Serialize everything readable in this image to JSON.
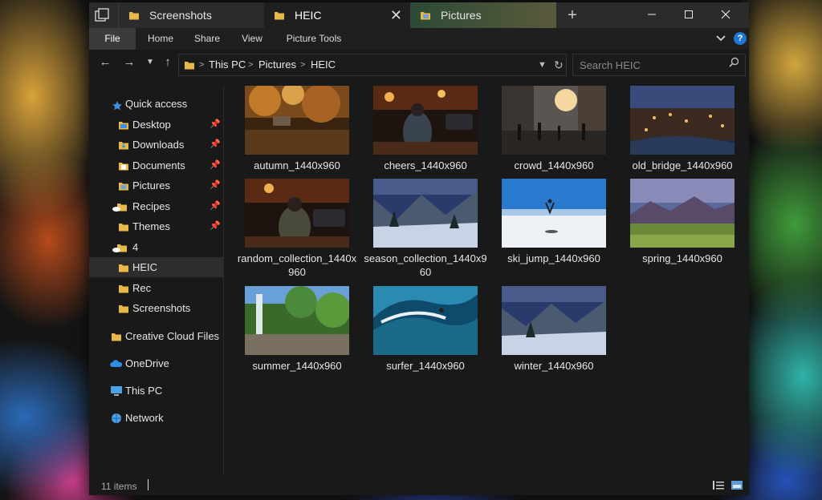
{
  "tabs": [
    {
      "label": "Screenshots"
    },
    {
      "label": "HEIC"
    },
    {
      "label": "Pictures"
    }
  ],
  "ribbon": {
    "file": "File",
    "home": "Home",
    "share": "Share",
    "view": "View",
    "picture_tools": "Picture Tools",
    "help": "?"
  },
  "address": {
    "crumbs": [
      "This PC",
      "Pictures",
      "HEIC"
    ]
  },
  "search": {
    "placeholder": "Search HEIC"
  },
  "sidebar": {
    "quick_access": "Quick access",
    "items": [
      {
        "label": "Desktop",
        "pinned": true
      },
      {
        "label": "Downloads",
        "pinned": true
      },
      {
        "label": "Documents",
        "pinned": true
      },
      {
        "label": "Pictures",
        "pinned": true
      },
      {
        "label": "Recipes",
        "pinned": true
      },
      {
        "label": "Themes",
        "pinned": true
      },
      {
        "label": "4"
      },
      {
        "label": "HEIC",
        "selected": true
      },
      {
        "label": "Rec"
      },
      {
        "label": "Screenshots"
      }
    ],
    "creative_cloud": "Creative Cloud Files",
    "onedrive": "OneDrive",
    "this_pc": "This PC",
    "network": "Network"
  },
  "files": [
    {
      "name": "autumn_1440x960",
      "icon": "autumn-photo"
    },
    {
      "name": "cheers_1440x960",
      "icon": "night-street-photo"
    },
    {
      "name": "crowd_1440x960",
      "icon": "crowd-street-photo"
    },
    {
      "name": "old_bridge_1440x960",
      "icon": "night-city-photo"
    },
    {
      "name": "random_collection_1440x960",
      "icon": "night-street-photo"
    },
    {
      "name": "season_collection_1440x960",
      "icon": "snowy-valley-photo"
    },
    {
      "name": "ski_jump_1440x960",
      "icon": "snowfield-photo"
    },
    {
      "name": "spring_1440x960",
      "icon": "mountain-meadow-photo"
    },
    {
      "name": "summer_1440x960",
      "icon": "waterfall-photo"
    },
    {
      "name": "surfer_1440x960",
      "icon": "surf-wave-photo"
    },
    {
      "name": "winter_1440x960",
      "icon": "snowy-valley-photo"
    }
  ],
  "status": {
    "item_count": "11 items"
  },
  "colors": {
    "accent": "#1f77d4",
    "folder": "#e8b84a",
    "window_bg": "#191919"
  }
}
